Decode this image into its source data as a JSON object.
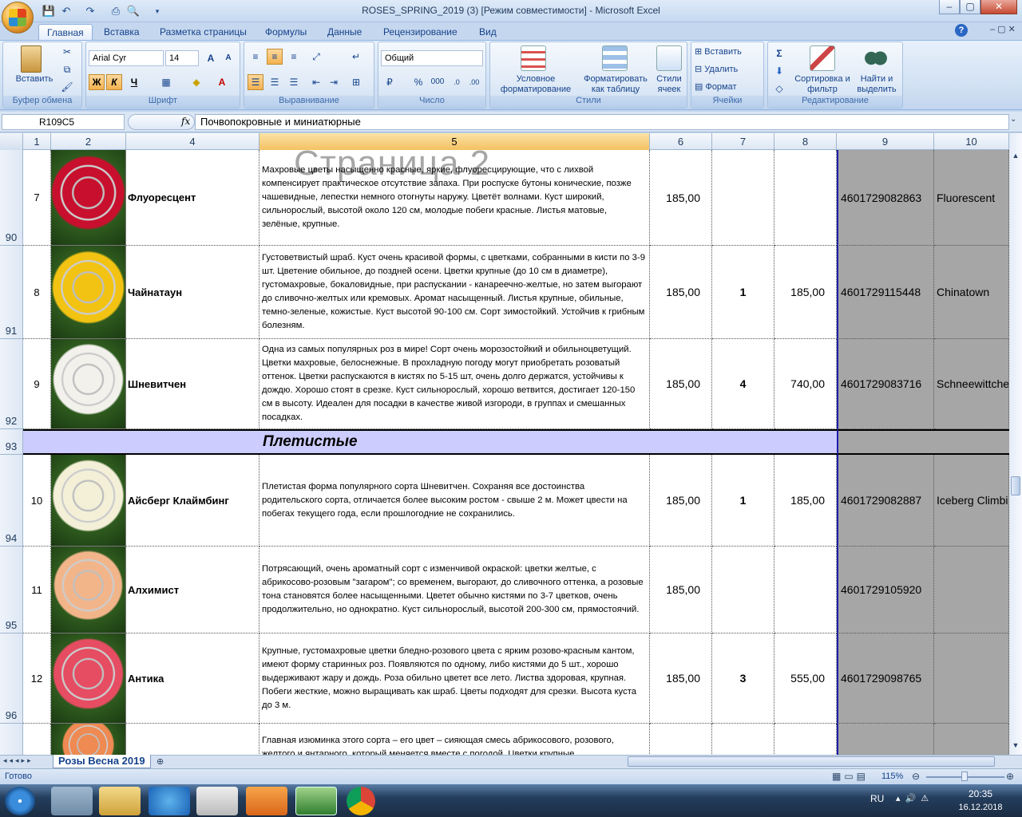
{
  "window": {
    "title": "ROSES_SPRING_2019 (3)  [Режим совместимости] - Microsoft Excel",
    "min": "–",
    "max": "▢",
    "close": "✕"
  },
  "ribbon_tabs": [
    "Главная",
    "Вставка",
    "Разметка страницы",
    "Формулы",
    "Данные",
    "Рецензирование",
    "Вид"
  ],
  "ribbon": {
    "clipboard": {
      "paste": "Вставить",
      "label": "Буфер обмена"
    },
    "font": {
      "name": "Arial Cyr",
      "size": "14",
      "bold": "Ж",
      "italic": "К",
      "underline": "Ч",
      "label": "Шрифт"
    },
    "alignment": {
      "label": "Выравнивание"
    },
    "number": {
      "format": "Общий",
      "percent": "%",
      "thousands": "000",
      "label": "Число"
    },
    "styles": {
      "conditional": "Условное форматирование",
      "as_table": "Форматировать как таблицу",
      "cell_styles": "Стили ячеек",
      "label": "Стили"
    },
    "cells": {
      "insert": "Вставить",
      "delete": "Удалить",
      "format": "Формат",
      "label": "Ячейки"
    },
    "editing": {
      "sigma": "Σ",
      "sort": "Сортировка и фильтр",
      "find": "Найти и выделить",
      "label": "Редактирование"
    }
  },
  "formula_bar": {
    "name_box": "R109C5",
    "fx": "fx",
    "formula": "Почвопокровные и миниатюрные"
  },
  "columns": [
    "1",
    "2",
    "4",
    "5",
    "6",
    "7",
    "8",
    "9",
    "10"
  ],
  "watermark": "Страница 2",
  "rows": [
    {
      "row": "90",
      "num": "7",
      "name": "Флуоресцент",
      "desc": "Махровые цветы насыщенно красные, яркие, флуоресцирующие, что с лихвой компенсирует практическое отсутствие запаха. При роспуске бутоны конические, позже чашевидные, лепестки немного отогнуты наружу. Цветёт волнами. Куст широкий, сильнорослый, высотой около 120 см, молодые побеги красные. Листья матовые, зелёные, крупные.",
      "price": "185,00",
      "qty": "",
      "sum": "",
      "code": "4601729082863",
      "latin": "Fluorescent",
      "color": "#c8102e"
    },
    {
      "row": "91",
      "num": "8",
      "name": "Чайнатаун",
      "desc": "Густоветвистый шраб. Куст очень красивой формы, с цветками, собранными в кисти по 3-9 шт. Цветение обильное, до поздней осени. Цветки крупные (до 10 см в диаметре), густомахровые, бокаловидные, при распускании - канареечно-желтые, но затем выгорают до сливочно-желтых или кремовых. Аромат насыщенный. Листья крупные, обильные, темно-зеленые, кожистые. Куст высотой 90-100 см. Сорт зимостойкий. Устойчив к грибным болезням.",
      "price": "185,00",
      "qty": "1",
      "sum": "185,00",
      "code": "4601729115448",
      "latin": "Chinatown",
      "color": "#f2c313"
    },
    {
      "row": "92",
      "num": "9",
      "name": "Шневитчен",
      "desc": "Одна из самых популярных роз в мире! Сорт очень морозостойкий и обильноцветущий. Цветки махровые, белоснежные. В прохладную погоду могут приобретать розоватый оттенок. Цветки распускаются в кистях по 5-15 шт, очень долго держатся, устойчивы к дождю. Хорошо стоят в срезке. Куст сильнорослый, хорошо ветвится, достигает 120-150 см в высоту. Идеален для посадки в качестве живой изгороди, в группах и смешанных посадках.",
      "price": "185,00",
      "qty": "4",
      "sum": "740,00",
      "code": "4601729083716",
      "latin": "Schneewittchen",
      "color": "#f3f1ec"
    },
    {
      "row": "94",
      "num": "10",
      "name": "Айсберг Клаймбинг",
      "desc": "Плетистая форма популярного сорта Шневитчен. Сохраняя все достоинства родительского сорта, отличается более высоким ростом - свыше 2 м. Может цвести на побегах текущего года, если прошлогодние не сохранились.",
      "price": "185,00",
      "qty": "1",
      "sum": "185,00",
      "code": "4601729082887",
      "latin": "Iceberg Climbing",
      "color": "#f4f0d8"
    },
    {
      "row": "95",
      "num": "11",
      "name": "Алхимист",
      "desc": "Потрясающий, очень ароматный сорт с изменчивой окраской: цветки желтые, с абрикосово-розовым \"загаром\"; со временем, выгорают, до сливочного оттенка, а розовые тона становятся более насыщенными. Цветет обычно кистями по 3-7 цветков, очень продолжительно, но однократно. Куст сильнорослый, высотой 200-300 см, прямостоячий.",
      "price": "185,00",
      "qty": "",
      "sum": "",
      "code": "4601729105920",
      "latin": "",
      "color": "#f2b58a"
    },
    {
      "row": "96",
      "num": "12",
      "name": "Антика",
      "desc": "Крупные, густомахровые цветки бледно-розового цвета с ярким розово-красным кантом, имеют форму старинных роз. Появляются по одному, либо кистями до 5 шт., хорошо выдерживают жару и дождь. Роза обильно цветет все лето.  Листва здоровая, крупная. Побеги жесткие, можно выращивать как шраб. Цветы подходят для срезки. Высота куста до 3 м.",
      "price": "185,00",
      "qty": "3",
      "sum": "555,00",
      "code": "4601729098765",
      "latin": "",
      "color": "#e64c62"
    },
    {
      "row": "",
      "num": "",
      "name": "",
      "desc": "Главная изюминка этого сорта – его цвет – сияющая смесь абрикосового, розового, желтого и янтарного, который меняется вместе с погодой. Цветки крупные",
      "price": "",
      "qty": "",
      "sum": "",
      "code": "",
      "latin": "",
      "color": "#ee8a52"
    }
  ],
  "section": {
    "row": "93",
    "title": "Плетистые"
  },
  "sheet_tab": "Розы Весна 2019",
  "status": {
    "ready": "Готово",
    "zoom": "115%"
  },
  "tray": {
    "lang": "RU",
    "time": "20:35",
    "date": "16.12.2018"
  }
}
